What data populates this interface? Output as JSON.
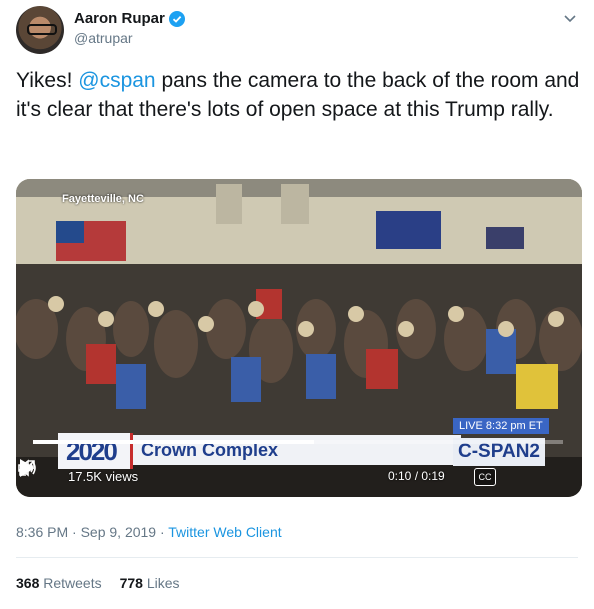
{
  "author": {
    "name": "Aaron Rupar",
    "handle": "@atrupar",
    "verified": true
  },
  "tweet": {
    "text_prefix": "Yikes! ",
    "mention": "@cspan",
    "text_suffix": " pans the camera to the back of the room and it's clear that there's lots of open space at this Trump rally."
  },
  "video": {
    "location_label": "Fayetteville, NC",
    "live_badge": "LIVE  8:32 pm ET",
    "network": "C-SPAN2",
    "lower_third_logo": "2020",
    "lower_third_title": "Crown Complex",
    "views": "17.5K views",
    "time": "0:10 / 0:19",
    "progress_fraction": 0.53,
    "cc_label": "CC"
  },
  "meta": {
    "timestamp": "8:36 PM · Sep 9, 2019 · ",
    "client": "Twitter Web Client"
  },
  "stats": {
    "retweets_count": "368",
    "retweets_label": "Retweets",
    "likes_count": "778",
    "likes_label": "Likes"
  },
  "colors": {
    "link": "#1b95e0",
    "verified": "#1da1f2",
    "cspan_blue": "#1f3e8c"
  },
  "icons": [
    "chevron-down-icon",
    "verified-badge-icon",
    "play-icon",
    "volume-icon",
    "fullscreen-icon"
  ]
}
